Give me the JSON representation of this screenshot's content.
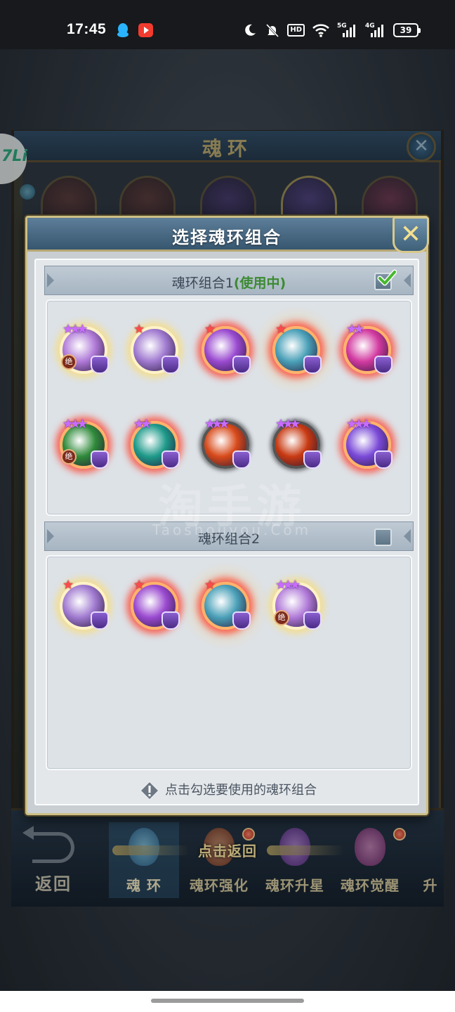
{
  "status_bar": {
    "time": "17:45",
    "icons": [
      "qq-icon",
      "video-app-icon",
      "moon-icon",
      "mute-icon",
      "hd-icon",
      "wifi-icon",
      "5g-signal-icon",
      "4g-signal-icon",
      "battery-icon"
    ],
    "hd_label": "HD",
    "net1": "5G",
    "net2": "4G",
    "battery": "39"
  },
  "background_window": {
    "title": "魂环",
    "logo": "7Li"
  },
  "dialog": {
    "title": "选择魂环组合",
    "close_icon": "close-x-icon",
    "combos": [
      {
        "name": "魂环组合1",
        "status": "(使用中)",
        "selected": true,
        "rings": [
          {
            "stars": "★★★",
            "star_color": "purple",
            "border": "gold",
            "jue": "绝",
            "color": "#b07ad8"
          },
          {
            "stars": "★",
            "star_color": "red",
            "border": "gold",
            "jue": "",
            "color": "#a07ad0"
          },
          {
            "stars": "★",
            "star_color": "red",
            "border": "red",
            "jue": "",
            "color": "#9a4ad0"
          },
          {
            "stars": "★",
            "star_color": "red",
            "border": "red",
            "jue": "",
            "color": "#4aa0b8"
          },
          {
            "stars": "★★",
            "star_color": "purple",
            "border": "red",
            "jue": "",
            "color": "#d23aa0"
          },
          {
            "stars": "★★★",
            "star_color": "purple",
            "border": "red",
            "jue": "绝",
            "color": "#2f8a3a"
          },
          {
            "stars": "★★",
            "star_color": "purple",
            "border": "red",
            "jue": "",
            "color": "#1e9a8a"
          },
          {
            "stars": "★★★",
            "star_color": "purple",
            "border": "black",
            "jue": "",
            "color": "#d84a1a"
          },
          {
            "stars": "★★★",
            "star_color": "purple",
            "border": "black",
            "jue": "",
            "color": "#c83a12"
          },
          {
            "stars": "★★★",
            "star_color": "purple",
            "border": "red",
            "jue": "",
            "color": "#7a4ad8"
          }
        ]
      },
      {
        "name": "魂环组合2",
        "status": "",
        "selected": false,
        "rings": [
          {
            "stars": "★",
            "star_color": "red",
            "border": "gold",
            "jue": "",
            "color": "#a07ad0"
          },
          {
            "stars": "★",
            "star_color": "red",
            "border": "red",
            "jue": "",
            "color": "#9a4ad0"
          },
          {
            "stars": "★",
            "star_color": "red",
            "border": "red",
            "jue": "",
            "color": "#4aa0b8"
          },
          {
            "stars": "★★★",
            "star_color": "purple",
            "border": "gold",
            "jue": "绝",
            "color": "#b07ad8"
          }
        ]
      }
    ],
    "hint": "点击勾选要使用的魂环组合"
  },
  "watermark": {
    "main": "淘手游",
    "sub": "Taoshouyou.Com"
  },
  "bottom_bar": {
    "back_label": "返回",
    "tap_return": "点击返回",
    "tabs": [
      "魂  环",
      "魂环强化",
      "魂环升星",
      "魂环觉醒"
    ],
    "partial_tab": "升"
  }
}
